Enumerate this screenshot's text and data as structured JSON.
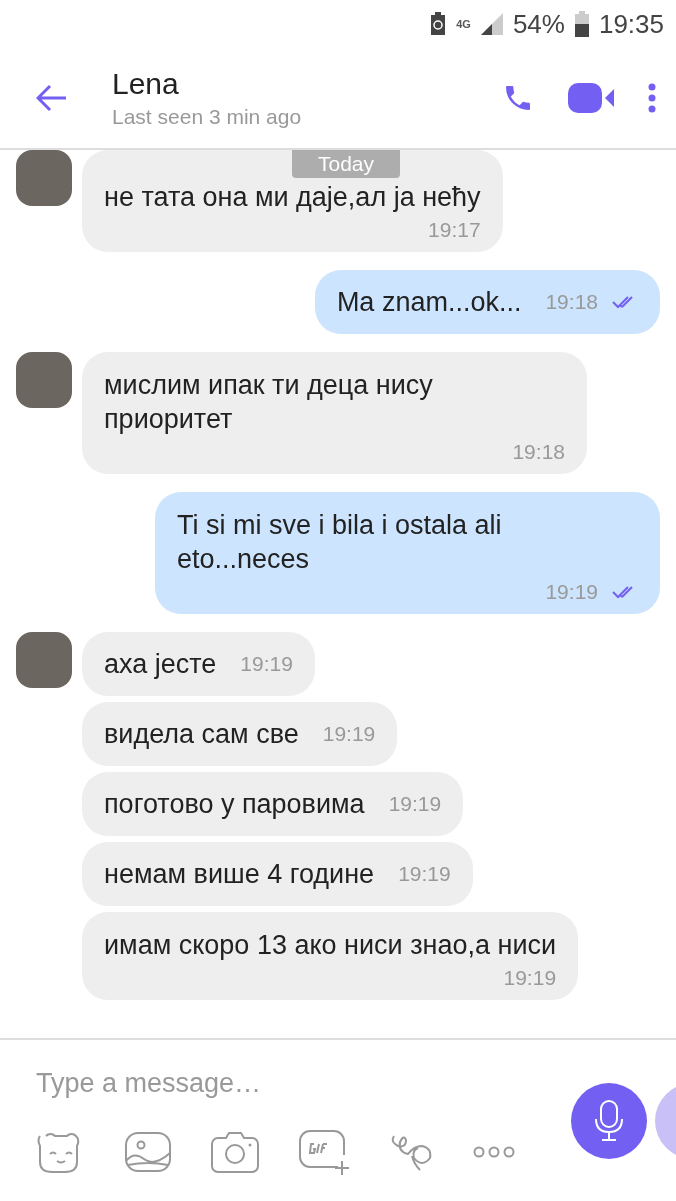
{
  "status_bar": {
    "network": "4G",
    "battery": "54%",
    "time": "19:35"
  },
  "header": {
    "name": "Lena",
    "subtitle": "Last seen 3 min ago"
  },
  "date_badge": "Today",
  "messages": [
    {
      "kind": "in",
      "avatar": true,
      "compact": false,
      "text": "не тата она ми даје,ал ја нећу",
      "time": "19:17"
    },
    {
      "kind": "out",
      "compact": true,
      "read": true,
      "text": "Ma znam...ok...",
      "time": "19:18"
    },
    {
      "kind": "in",
      "avatar": true,
      "compact": false,
      "text": "мислим ипак ти деца нису приоритет",
      "time": "19:18"
    },
    {
      "kind": "out",
      "compact": false,
      "read": true,
      "text": "Ti si mi sve i bila i ostala ali eto...neces",
      "time": "19:19"
    },
    {
      "kind": "in",
      "avatar": true,
      "compact": true,
      "text": "аха јесте",
      "time": "19:19"
    },
    {
      "kind": "in",
      "avatar": false,
      "compact": true,
      "text": "видела сам све",
      "time": "19:19"
    },
    {
      "kind": "in",
      "avatar": false,
      "compact": true,
      "text": "поготово у паровима",
      "time": "19:19"
    },
    {
      "kind": "in",
      "avatar": false,
      "compact": true,
      "text": "немам више 4 године",
      "time": "19:19"
    },
    {
      "kind": "in",
      "avatar": false,
      "compact": false,
      "text": "имам скоро 13 ако ниси знао,а ниси",
      "time": "19:19"
    }
  ],
  "composer": {
    "placeholder": "Type a message…"
  }
}
